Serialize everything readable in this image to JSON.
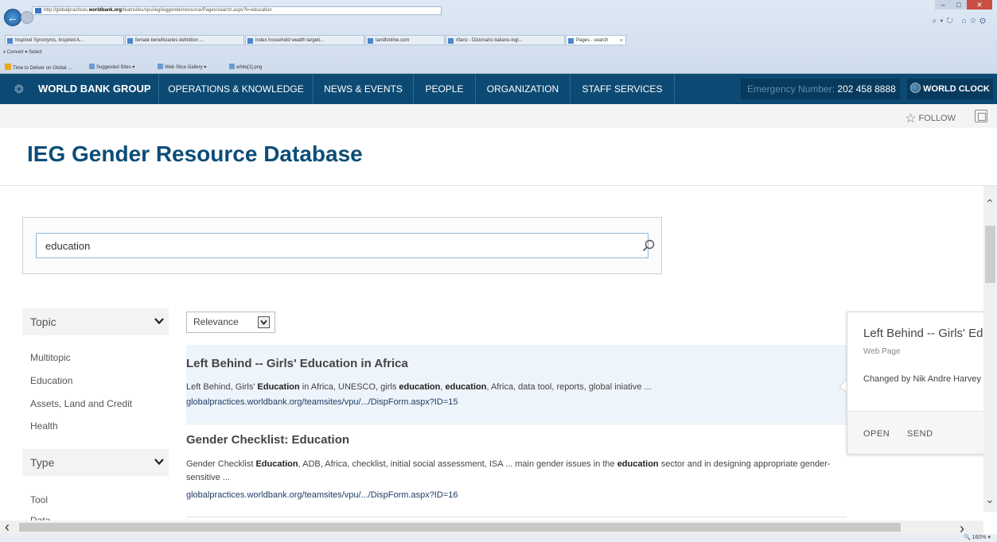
{
  "browser": {
    "url_prefix": "http://globalpractices.",
    "url_domain": "worldbank.org",
    "url_rest": "/teamsites/vpu/ieg/ieggenderresource/Pages/search.aspx?k=education",
    "tabs": [
      {
        "label": "Inspired Synonyms, Inspired A..."
      },
      {
        "label": "female beneficiaries definition ..."
      },
      {
        "label": "index household wealth targeti..."
      },
      {
        "label": "tandfonline.com"
      },
      {
        "label": "rifarsi - Dizionario italiano-ingl..."
      },
      {
        "label": "Pages - search"
      }
    ],
    "tab_close": "×",
    "command_bar": "x  Convert ▾  Select",
    "favorites": [
      {
        "label": "Time to Deliver on Global ..."
      },
      {
        "label": "Suggested Sites ▾"
      },
      {
        "label": "Web Slice Gallery ▾"
      },
      {
        "label": "white[1].png"
      }
    ],
    "zoom": "160%"
  },
  "topnav": {
    "brand": "WORLD BANK GROUP",
    "items": [
      {
        "label": "OPERATIONS & KNOWLEDGE"
      },
      {
        "label": "NEWS & EVENTS"
      },
      {
        "label": "PEOPLE"
      },
      {
        "label": "ORGANIZATION"
      },
      {
        "label": "STAFF SERVICES"
      }
    ],
    "emergency_label": "Emergency Number:",
    "emergency_number": "202 458 8888",
    "world_clock": "WORLD CLOCK"
  },
  "suitebar": {
    "follow": "FOLLOW"
  },
  "page": {
    "title": "IEG Gender Resource Database"
  },
  "search": {
    "value": "education"
  },
  "refiners": {
    "topic": {
      "title": "Topic",
      "items": [
        "Multitopic",
        "Education",
        "Assets, Land and Credit",
        "Health"
      ]
    },
    "type": {
      "title": "Type",
      "items": [
        "Tool",
        "Data"
      ]
    }
  },
  "sort": {
    "selected": "Relevance"
  },
  "results": [
    {
      "title": "Left Behind -- Girls' Education in Africa",
      "snippet_parts": [
        "Left Behind, Girls' ",
        "Education",
        " in Africa, UNESCO, girls ",
        "education",
        ", ",
        "education",
        ", Africa, data tool, reports, global iniative ..."
      ],
      "url_parts": [
        "globalpractices.",
        "worldbank.org",
        "/teamsites/vpu/.../DispForm.aspx?ID=15"
      ]
    },
    {
      "title": "Gender Checklist: Education",
      "snippet_parts": [
        "Gender Checklist ",
        "Education",
        ", ADB, Africa, checklist, initial social assessment, ISA ... main gender issues in the ",
        "education",
        " sector and in designing appropriate gender-sensitive ..."
      ],
      "url_parts": [
        "globalpractices.",
        "worldbank.org",
        "/teamsites/vpu/.../DispForm.aspx?ID=16"
      ]
    }
  ],
  "callout": {
    "title": "Left Behind -- Girls' Education in Africa",
    "type": "Web Page",
    "changed": "Changed by Nik Andre Harvey",
    "open": "OPEN",
    "send": "SEND"
  },
  "colors": {
    "nav_bg": "#0c4a73",
    "title_blue": "#0b4d78",
    "highlight_bg": "#eef4fb"
  }
}
